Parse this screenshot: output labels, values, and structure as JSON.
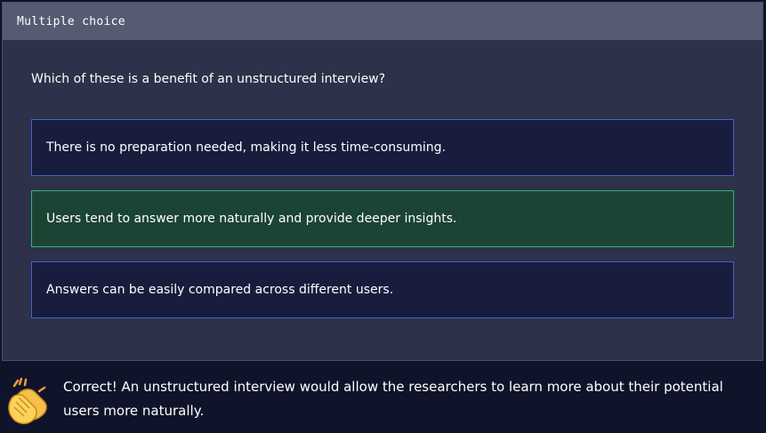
{
  "panel": {
    "header_title": "Multiple choice",
    "question": "Which of these is a benefit of an unstructured interview?",
    "options": [
      {
        "label": "There is no preparation needed, making it less time-consuming.",
        "state": "default"
      },
      {
        "label": "Users tend to answer more naturally and provide deeper insights.",
        "state": "correct"
      },
      {
        "label": "Answers can be easily compared across different users.",
        "state": "default"
      }
    ]
  },
  "feedback": {
    "icon": "clapping-hands-icon",
    "text": "Correct! An unstructured interview would allow the researchers to learn more about their potential users more naturally."
  },
  "colors": {
    "correct_fill": "#1b4434",
    "correct_border": "#3bb27a",
    "option_border": "#4461d1"
  }
}
